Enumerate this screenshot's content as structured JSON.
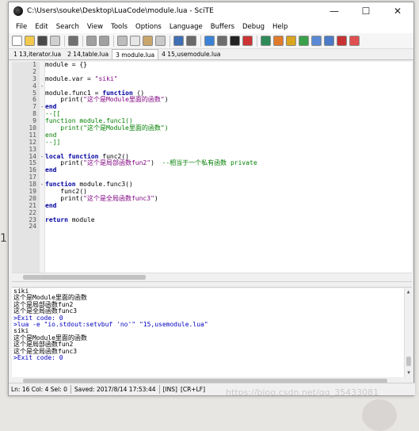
{
  "window": {
    "title": "C:\\Users\\souke\\Desktop\\LuaCode\\module.lua - SciTE",
    "controls": {
      "minimize": "—",
      "maximize": "☐",
      "close": "✕"
    }
  },
  "menu": [
    "File",
    "Edit",
    "Search",
    "View",
    "Tools",
    "Options",
    "Language",
    "Buffers",
    "Debug",
    "Help"
  ],
  "toolbar": {
    "icons": [
      {
        "name": "new-file-icon",
        "color": "#ffffff"
      },
      {
        "name": "open-folder-icon",
        "color": "#f2c94c"
      },
      {
        "name": "save-icon",
        "color": "#4a4a4a"
      },
      {
        "name": "close-file-icon",
        "color": "#d0d0d0"
      },
      {
        "name": "print-icon",
        "color": "#707070"
      },
      {
        "name": "undo-icon",
        "color": "#a0a0a0"
      },
      {
        "name": "redo-icon",
        "color": "#a0a0a0"
      },
      {
        "name": "cut-icon",
        "color": "#bdbdbd"
      },
      {
        "name": "copy-icon",
        "color": "#e6e6e6"
      },
      {
        "name": "paste-icon",
        "color": "#c9a66b"
      },
      {
        "name": "delete-icon",
        "color": "#c9c9c9"
      },
      {
        "name": "find-icon",
        "color": "#3f6fb5"
      },
      {
        "name": "replace-icon",
        "color": "#6a6a6a"
      },
      {
        "name": "compile-icon",
        "color": "#3b82d6"
      },
      {
        "name": "build-icon",
        "color": "#6e6e6e"
      },
      {
        "name": "go-icon",
        "color": "#222222"
      },
      {
        "name": "stop-icon",
        "color": "#cc3333"
      },
      {
        "name": "tools-icon",
        "color": "#2e8b57"
      },
      {
        "name": "flag-icon",
        "color": "#e07b2c"
      },
      {
        "name": "arrow-icon",
        "color": "#d9a520"
      },
      {
        "name": "bookmark-icon",
        "color": "#3aa04a"
      },
      {
        "name": "window-icon",
        "color": "#5a8ad6"
      },
      {
        "name": "panel-icon",
        "color": "#4a7ac8"
      },
      {
        "name": "config-icon",
        "color": "#c83232"
      },
      {
        "name": "exit-icon",
        "color": "#e05050"
      }
    ]
  },
  "tabs": [
    {
      "label": "1 13,iterator.lua",
      "active": false
    },
    {
      "label": "2 14,table.lua",
      "active": false
    },
    {
      "label": "3 module.lua",
      "active": true
    },
    {
      "label": "4 15,usemodule.lua",
      "active": false
    }
  ],
  "editor": {
    "fold_markers": [
      "",
      "",
      "",
      "-",
      "",
      "",
      "-",
      "",
      "",
      "",
      "",
      "",
      "",
      "-",
      "",
      "",
      "",
      "-",
      "",
      "",
      "",
      "",
      "",
      ""
    ],
    "lines": [
      {
        "num": "1",
        "segments": [
          {
            "t": "module = {}",
            "c": "plain"
          }
        ]
      },
      {
        "num": "2",
        "segments": []
      },
      {
        "num": "3",
        "segments": [
          {
            "t": "module.var = ",
            "c": "plain"
          },
          {
            "t": "\"siki\"",
            "c": "str"
          }
        ]
      },
      {
        "num": "4",
        "segments": []
      },
      {
        "num": "5",
        "segments": [
          {
            "t": "module.func1 = ",
            "c": "plain"
          },
          {
            "t": "function",
            "c": "kw"
          },
          {
            "t": " ()",
            "c": "plain"
          }
        ]
      },
      {
        "num": "6",
        "segments": [
          {
            "t": "    print(",
            "c": "plain"
          },
          {
            "t": "\"这个是Module里面的函数\"",
            "c": "str"
          },
          {
            "t": ")",
            "c": "plain"
          }
        ]
      },
      {
        "num": "7",
        "segments": [
          {
            "t": "end",
            "c": "kw"
          }
        ]
      },
      {
        "num": "8",
        "segments": [
          {
            "t": "--[[",
            "c": "com"
          }
        ]
      },
      {
        "num": "9",
        "segments": [
          {
            "t": "function module.func1()",
            "c": "com"
          }
        ]
      },
      {
        "num": "10",
        "segments": [
          {
            "t": "    print(\"这个是Module里面的函数\")",
            "c": "com"
          }
        ]
      },
      {
        "num": "11",
        "segments": [
          {
            "t": "end",
            "c": "com"
          }
        ]
      },
      {
        "num": "12",
        "segments": [
          {
            "t": "--]]",
            "c": "com"
          }
        ]
      },
      {
        "num": "13",
        "segments": []
      },
      {
        "num": "14",
        "segments": [
          {
            "t": "local",
            "c": "kw"
          },
          {
            "t": " ",
            "c": "plain"
          },
          {
            "t": "function",
            "c": "kw"
          },
          {
            "t": " func2()",
            "c": "plain"
          }
        ]
      },
      {
        "num": "15",
        "segments": [
          {
            "t": "    print(",
            "c": "plain"
          },
          {
            "t": "\"这个是局部函数fun2\"",
            "c": "str"
          },
          {
            "t": ")  ",
            "c": "plain"
          },
          {
            "t": "--相当于一个私有函数 private",
            "c": "com"
          }
        ]
      },
      {
        "num": "16",
        "segments": [
          {
            "t": "end",
            "c": "kw"
          }
        ]
      },
      {
        "num": "17",
        "segments": []
      },
      {
        "num": "18",
        "segments": [
          {
            "t": "function",
            "c": "kw"
          },
          {
            "t": " module.func3()",
            "c": "plain"
          }
        ]
      },
      {
        "num": "19",
        "segments": [
          {
            "t": "    func2()",
            "c": "plain"
          }
        ]
      },
      {
        "num": "20",
        "segments": [
          {
            "t": "    print(",
            "c": "plain"
          },
          {
            "t": "\"这个是全局函数func3\"",
            "c": "str"
          },
          {
            "t": ")",
            "c": "plain"
          }
        ]
      },
      {
        "num": "21",
        "segments": [
          {
            "t": "end",
            "c": "kw"
          }
        ]
      },
      {
        "num": "22",
        "segments": []
      },
      {
        "num": "23",
        "segments": [
          {
            "t": "return",
            "c": "kw"
          },
          {
            "t": " module",
            "c": "plain"
          }
        ]
      },
      {
        "num": "24",
        "segments": []
      }
    ]
  },
  "output": {
    "lines": [
      {
        "t": "siki",
        "c": ""
      },
      {
        "t": "这个是Module里面的函数",
        "c": ""
      },
      {
        "t": "这个是局部函数fun2",
        "c": ""
      },
      {
        "t": "这个是全局函数func3",
        "c": ""
      },
      {
        "t": ">Exit code: 0",
        "c": "exit"
      },
      {
        "t": ">lua -e \"io.stdout:setvbuf 'no'\" \"15,usemodule.lua\"",
        "c": "cmd"
      },
      {
        "t": "siki",
        "c": ""
      },
      {
        "t": "这个是Module里面的函数",
        "c": ""
      },
      {
        "t": "这个是局部函数fun2",
        "c": ""
      },
      {
        "t": "这个是全局函数func3",
        "c": ""
      },
      {
        "t": ">Exit code: 0",
        "c": "exit"
      }
    ]
  },
  "status": {
    "position": "Ln: 16 Col: 4 Sel: 0",
    "selection": "|",
    "saved": "Saved: 2017/8/14  17:53:44",
    "mode": "[INS]",
    "eol": "[CR+LF]"
  },
  "watermark": "https://blog.csdn.net/qq_35433081",
  "background_glyph": "1."
}
